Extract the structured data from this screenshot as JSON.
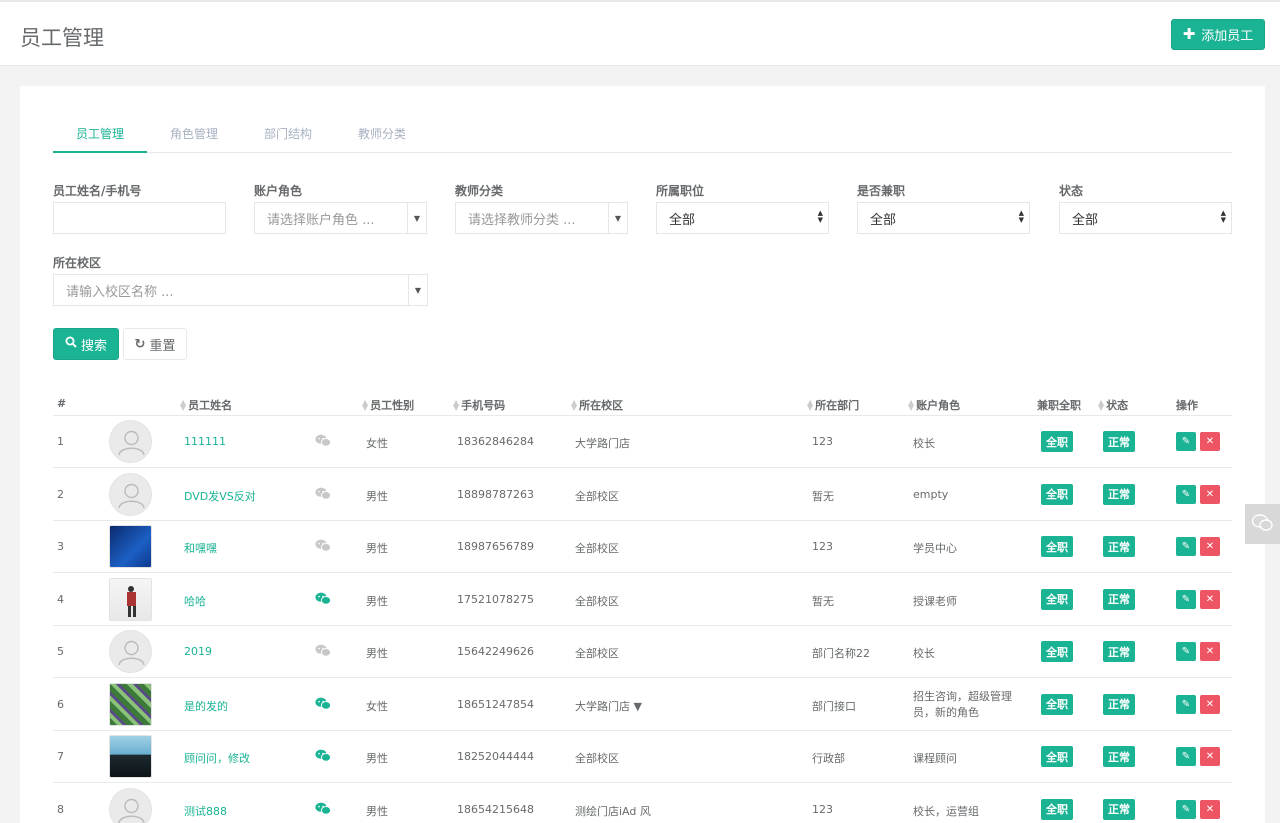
{
  "header": {
    "title": "员工管理",
    "add_button": "添加员工"
  },
  "tabs": [
    "员工管理",
    "角色管理",
    "部门结构",
    "教师分类"
  ],
  "filters": {
    "name_label": "员工姓名/手机号",
    "role_label": "账户角色",
    "role_placeholder": "请选择账户角色 ...",
    "teacher_label": "教师分类",
    "teacher_placeholder": "请选择教师分类 ...",
    "position_label": "所属职位",
    "position_value": "全部",
    "parttime_label": "是否兼职",
    "parttime_value": "全部",
    "status_label": "状态",
    "status_value": "全部",
    "campus_label": "所在校区",
    "campus_placeholder": "请输入校区名称 ..."
  },
  "buttons": {
    "search": "搜索",
    "reset": "重置"
  },
  "table": {
    "headers": [
      "#",
      "员工姓名",
      "员工性别",
      "手机号码",
      "所在校区",
      "所在部门",
      "账户角色",
      "兼职全职",
      "状态",
      "操作"
    ],
    "rows": [
      {
        "index": "1",
        "name": "111111",
        "gender": "女性",
        "phone": "18362846284",
        "campus": "大学路门店",
        "dept": "123",
        "role": "校长",
        "type": "全职",
        "status": "正常",
        "avatar": "default",
        "wechat": false
      },
      {
        "index": "2",
        "name": "DVD发VS反对",
        "gender": "男性",
        "phone": "18898787263",
        "campus": "全部校区",
        "dept": "暂无",
        "role": "empty",
        "type": "全职",
        "status": "正常",
        "avatar": "default",
        "wechat": false
      },
      {
        "index": "3",
        "name": "和嘿嘿",
        "gender": "男性",
        "phone": "18987656789",
        "campus": "全部校区",
        "dept": "123",
        "role": "学员中心",
        "type": "全职",
        "status": "正常",
        "avatar": "blue-photo",
        "wechat": false
      },
      {
        "index": "4",
        "name": "哈哈",
        "gender": "男性",
        "phone": "17521078275",
        "campus": "全部校区",
        "dept": "暂无",
        "role": "授课老师",
        "type": "全职",
        "status": "正常",
        "avatar": "person-photo",
        "wechat": true
      },
      {
        "index": "5",
        "name": "2019",
        "gender": "男性",
        "phone": "15642249626",
        "campus": "全部校区",
        "dept": "部门名称22",
        "role": "校长",
        "type": "全职",
        "status": "正常",
        "avatar": "default",
        "wechat": false
      },
      {
        "index": "6",
        "name": "是的发的",
        "gender": "女性",
        "phone": "18651247854",
        "campus": "大学路门店 ▼",
        "dept": "部门接口",
        "role": "招生咨询，超级管理员，新的角色",
        "type": "全职",
        "status": "正常",
        "avatar": "green-photo",
        "wechat": true
      },
      {
        "index": "7",
        "name": "顾问问，修改",
        "gender": "男性",
        "phone": "18252044444",
        "campus": "全部校区",
        "dept": "行政部",
        "role": "课程顾问",
        "type": "全职",
        "status": "正常",
        "avatar": "sky-photo",
        "wechat": true
      },
      {
        "index": "8",
        "name": "测试888",
        "gender": "男性",
        "phone": "18654215648",
        "campus": "测绘门店iAd 风",
        "dept": "123",
        "role": "校长，运营组",
        "type": "全职",
        "status": "正常",
        "avatar": "default",
        "wechat": true
      }
    ]
  },
  "colors": {
    "accent": "#1ab394",
    "danger": "#ed5565"
  }
}
